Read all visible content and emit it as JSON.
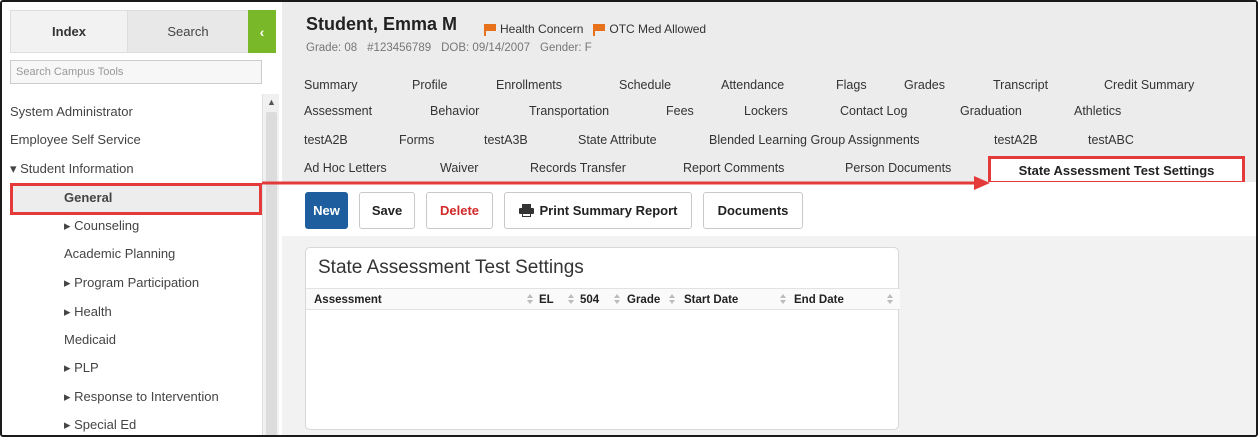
{
  "sidebar": {
    "tabs": {
      "index": "Index",
      "search": "Search",
      "collapse": "‹"
    },
    "search_placeholder": "Search Campus Tools",
    "items": [
      {
        "label": "System Administrator"
      },
      {
        "label": "Employee Self Service"
      },
      {
        "label": "▾ Student Information"
      },
      {
        "label": "General"
      },
      {
        "label": "▸ Counseling"
      },
      {
        "label": "Academic Planning"
      },
      {
        "label": "▸ Program Participation"
      },
      {
        "label": "▸ Health"
      },
      {
        "label": "Medicaid"
      },
      {
        "label": "▸ PLP"
      },
      {
        "label": "▸ Response to Intervention"
      },
      {
        "label": "▸ Special Ed"
      }
    ]
  },
  "student": {
    "name": "Student, Emma M",
    "flags": [
      "Health Concern",
      "OTC Med Allowed"
    ],
    "grade": "Grade: 08",
    "id": "#123456789",
    "dob": "DOB: 09/14/2007",
    "gender": "Gender: F"
  },
  "nav": {
    "row1": [
      "Summary",
      "Profile",
      "Enrollments",
      "Schedule",
      "Attendance",
      "Flags",
      "Grades",
      "Transcript",
      "Credit Summary"
    ],
    "row2": [
      "Assessment",
      "Behavior",
      "Transportation",
      "Fees",
      "Lockers",
      "Contact Log",
      "Graduation",
      "Athletics"
    ],
    "row3": [
      "testA2B",
      "Forms",
      "testA3B",
      "State Attribute",
      "Blended Learning Group Assignments",
      "testA2B",
      "testABC"
    ],
    "row4": [
      "Ad Hoc Letters",
      "Waiver",
      "Records Transfer",
      "Report Comments",
      "Person Documents"
    ],
    "active": "State Assessment Test Settings"
  },
  "toolbar": {
    "new": "New",
    "save": "Save",
    "delete": "Delete",
    "print": "Print Summary Report",
    "documents": "Documents"
  },
  "panel": {
    "title": "State Assessment Test Settings",
    "columns": [
      "Assessment",
      "EL",
      "504",
      "Grade",
      "Start Date",
      "End Date"
    ]
  },
  "colors": {
    "accent_blue": "#1f5e9e",
    "flag_orange": "#e8711c",
    "annotation_red": "#e43a3a",
    "collapse_green": "#79b829"
  }
}
